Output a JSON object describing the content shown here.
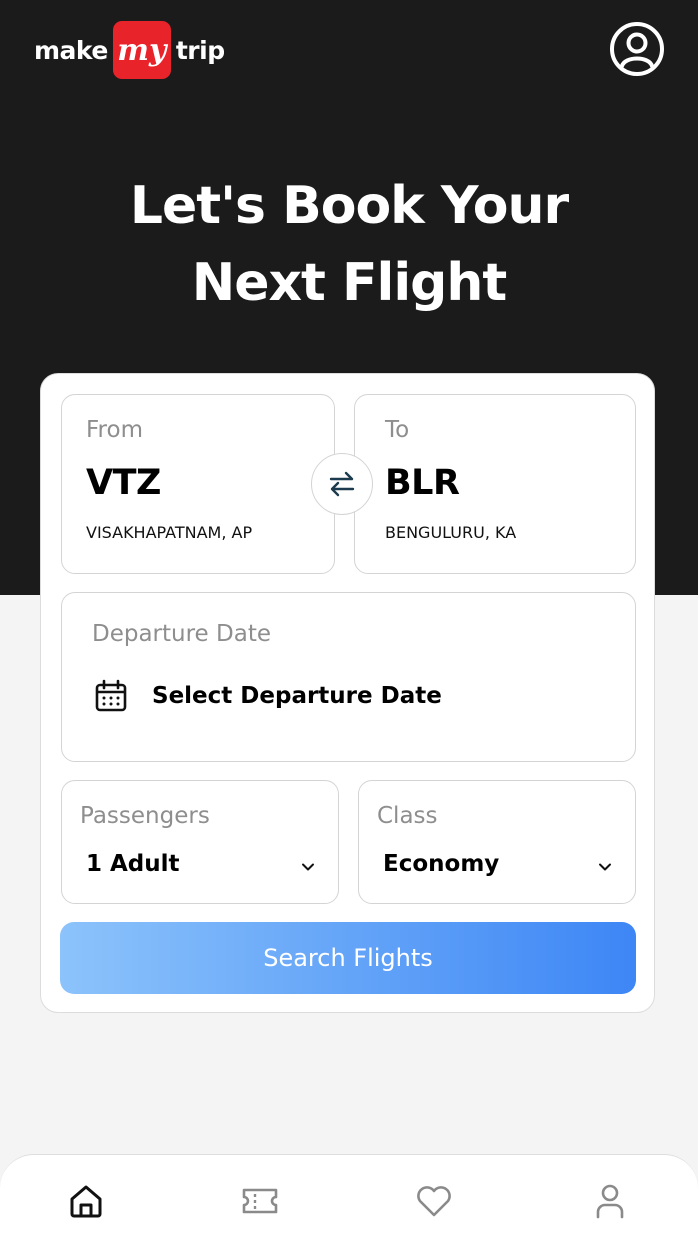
{
  "header": {
    "logo_left": "make",
    "logo_badge": "my",
    "logo_right": "trip",
    "brand_color": "#e8232a",
    "profile_icon": "user-circle-icon"
  },
  "hero": {
    "title_line1": "Let's Book Your",
    "title_line2": "Next Flight"
  },
  "from": {
    "label": "From",
    "code": "VTZ",
    "city": "VISAKHAPATNAM, AP"
  },
  "to": {
    "label": "To",
    "code": "BLR",
    "city": "BENGULURU, KA"
  },
  "swap_icon": "swap-arrows-icon",
  "departure": {
    "label": "Departure Date",
    "value": "Select Departure Date",
    "icon": "calendar-icon"
  },
  "passengers": {
    "label": "Passengers",
    "value": "1 Adult"
  },
  "travel_class": {
    "label": "Class",
    "value": "Economy"
  },
  "search_button": {
    "label": "Search Flights",
    "gradient_start": "#8cc3fb",
    "gradient_end": "#3d86f5"
  },
  "bottom_nav": {
    "items": [
      "home-icon",
      "ticket-icon",
      "heart-icon",
      "user-icon"
    ],
    "active": "home-icon"
  }
}
